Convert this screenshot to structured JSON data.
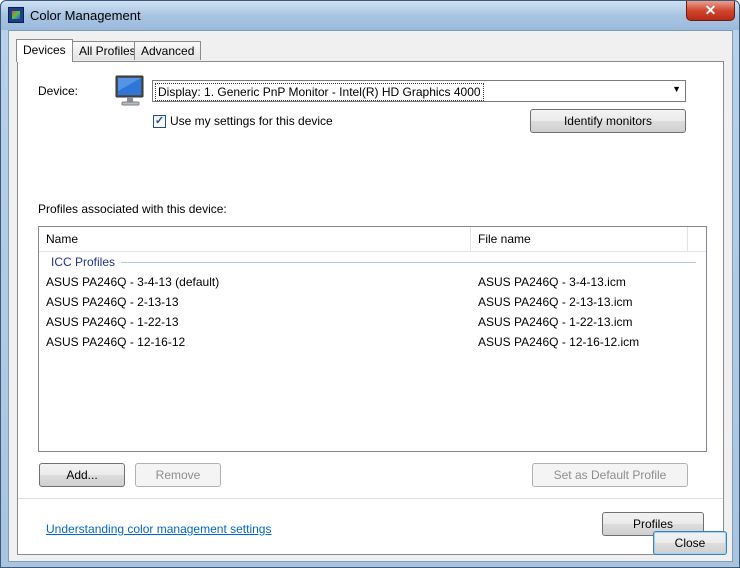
{
  "window": {
    "title": "Color Management",
    "close_glyph": "✕"
  },
  "tabs": [
    {
      "label": "Devices",
      "active": true
    },
    {
      "label": "All Profiles",
      "active": false
    },
    {
      "label": "Advanced",
      "active": false
    }
  ],
  "device": {
    "label": "Device:",
    "selected": "Display: 1. Generic PnP Monitor - Intel(R) HD Graphics 4000",
    "icon": "monitor-icon"
  },
  "use_settings": {
    "label": "Use my settings for this device",
    "checked": true
  },
  "identify_button": "Identify monitors",
  "profiles_label": "Profiles associated with this device:",
  "table": {
    "columns": [
      "Name",
      "File name"
    ],
    "group": "ICC Profiles",
    "rows": [
      {
        "name": "ASUS PA246Q - 3-4-13 (default)",
        "file": "ASUS PA246Q - 3-4-13.icm"
      },
      {
        "name": "ASUS PA246Q - 2-13-13",
        "file": "ASUS PA246Q - 2-13-13.icm"
      },
      {
        "name": "ASUS PA246Q - 1-22-13",
        "file": "ASUS PA246Q - 1-22-13.icm"
      },
      {
        "name": "ASUS PA246Q - 12-16-12",
        "file": "ASUS PA246Q - 12-16-12.icm"
      }
    ]
  },
  "buttons": {
    "add": "Add...",
    "remove": "Remove",
    "set_default": "Set as Default Profile",
    "profiles": "Profiles",
    "close": "Close"
  },
  "link": "Understanding color management settings",
  "colors": {
    "link": "#0066cc",
    "group_header": "#1e3287"
  }
}
